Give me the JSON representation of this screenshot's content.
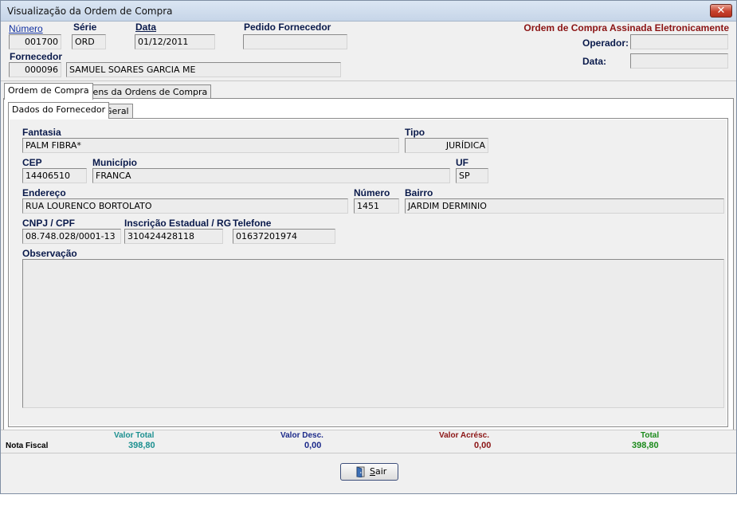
{
  "window": {
    "title": "Visualização da Ordem de Compra",
    "close_glyph": "✕"
  },
  "header": {
    "numero_label": "Número",
    "numero_value": "001700",
    "serie_label": "Série",
    "serie_value": "ORD",
    "data_label": "Data",
    "data_value": "01/12/2011",
    "pedido_label": "Pedido Fornecedor",
    "pedido_value": "",
    "fornecedor_label": "Fornecedor",
    "fornecedor_code": "000096",
    "fornecedor_name": "SAMUEL SOARES GARCIA ME",
    "assinada_label": "Ordem de Compra Assinada Eletronicamente",
    "operador_label": "Operador:",
    "operador_value": "",
    "data2_label": "Data:",
    "data2_value": ""
  },
  "tabs": [
    {
      "label": "Ordem de Compra",
      "active": true
    },
    {
      "label": "Itens da Ordens de Compra",
      "active": false
    }
  ],
  "subtabs": [
    {
      "label": "Dados do Fornecedor",
      "active": true
    },
    {
      "label": "Geral",
      "active": false
    }
  ],
  "supplier": {
    "fantasia_label": "Fantasia",
    "fantasia_value": "PALM FIBRA*",
    "tipo_label": "Tipo",
    "tipo_value": "JURÍDICA",
    "cep_label": "CEP",
    "cep_value": "14406510",
    "municipio_label": "Município",
    "municipio_value": "FRANCA",
    "uf_label": "UF",
    "uf_value": "SP",
    "endereco_label": "Endereço",
    "endereco_value": "RUA LOURENCO BORTOLATO",
    "numero_label": "Número",
    "numero_value": "1451",
    "bairro_label": "Bairro",
    "bairro_value": "JARDIM DERMINIO",
    "cnpj_label": "CNPJ / CPF",
    "cnpj_value": "08.748.028/0001-13",
    "ie_label": "Inscrição Estadual / RG",
    "ie_value": "310424428118",
    "telefone_label": "Telefone",
    "telefone_value": "01637201974",
    "observacao_label": "Observação",
    "observacao_value": ""
  },
  "totals": {
    "row_label": "Nota Fiscal",
    "valor_total_label": "Valor Total",
    "valor_total_value": "398,80",
    "valor_desc_label": "Valor Desc.",
    "valor_desc_value": "0,00",
    "valor_acresc_label": "Valor Acrésc.",
    "valor_acresc_value": "0,00",
    "total_label": "Total",
    "total_value": "398,80"
  },
  "colors": {
    "teal": "#1b8f8f",
    "navy": "#1c2a8a",
    "maroon": "#8b1414",
    "green": "#1a8a1a"
  },
  "buttons": {
    "sair_label": "Sair",
    "sair_icon": "door-exit-icon"
  }
}
